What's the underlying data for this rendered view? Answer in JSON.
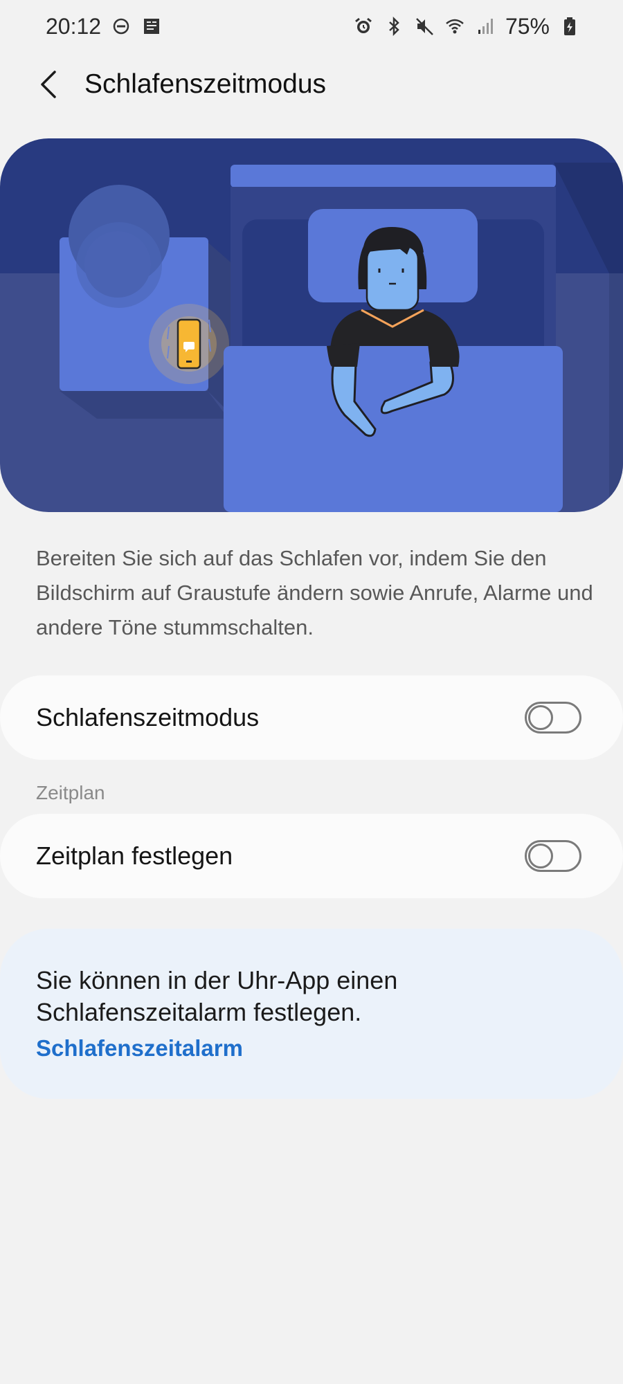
{
  "status_bar": {
    "time": "20:12",
    "battery": "75%",
    "left_icons": [
      "do-not-disturb-icon",
      "notification-app-icon"
    ],
    "right_icons": [
      "alarm-icon",
      "bluetooth-icon",
      "mute-icon",
      "wifi-icon",
      "signal-icon",
      "battery-icon"
    ]
  },
  "header": {
    "back_icon": "back-arrow-icon",
    "title": "Schlafenszeitmodus"
  },
  "description": "Bereiten Sie sich auf das Schlafen vor, indem Sie den Bildschirm auf Graustufe ändern sowie Anrufe, Alarme und andere Töne stummschalten.",
  "bedtime_toggle": {
    "label": "Schlafenszeitmodus",
    "enabled": false
  },
  "schedule": {
    "section_title": "Zeitplan",
    "label": "Zeitplan festlegen",
    "enabled": false
  },
  "info": {
    "text": "Sie können in der Uhr-App einen Schlafenszeitalarm festlegen.",
    "link": "Schlafenszeitalarm"
  },
  "colors": {
    "background": "#f2f2f2",
    "card": "#fbfbfb",
    "info_card": "#ebf2fa",
    "link": "#1f6fcb",
    "hero_dark": "#2a3a7e",
    "hero_blue": "#5a78d8",
    "phone_glow": "#f7b733"
  }
}
